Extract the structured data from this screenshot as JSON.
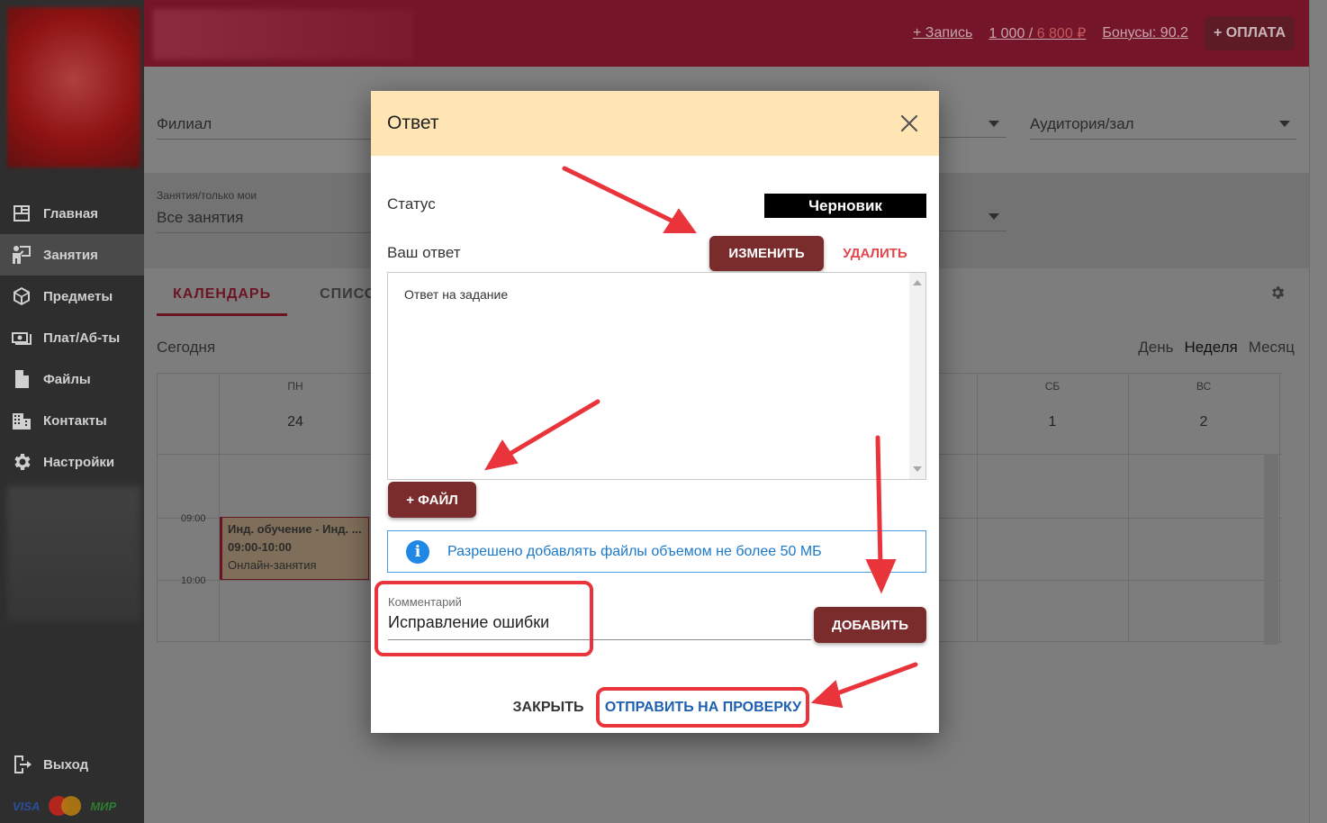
{
  "header": {
    "links": {
      "record": "+ Запись",
      "balance_prefix": "1 000 / ",
      "balance_debt": "6 800 ₽",
      "bonuses": "Бонусы: 90.2"
    },
    "pay_button": "+ ОПЛАТА"
  },
  "sidebar": {
    "items": [
      {
        "label": "Главная",
        "icon": "dashboard-icon"
      },
      {
        "label": "Занятия",
        "icon": "teacher-icon",
        "active": true
      },
      {
        "label": "Предметы",
        "icon": "cube-icon"
      },
      {
        "label": "Плат/Аб-ты",
        "icon": "money-icon"
      },
      {
        "label": "Файлы",
        "icon": "file-icon"
      },
      {
        "label": "Контакты",
        "icon": "building-icon"
      },
      {
        "label": "Настройки",
        "icon": "gear-icon"
      }
    ],
    "logout": "Выход",
    "payment_logos": {
      "visa": "VISA",
      "mir": "МИР"
    }
  },
  "filters": {
    "branch": "Филиал",
    "room": "Аудитория/зал",
    "lessons_label": "Занятия/только мои",
    "lessons_value": "Все занятия"
  },
  "calendar": {
    "tabs": {
      "calendar": "КАЛЕНДАРЬ",
      "list": "СПИСОК"
    },
    "today": "Сегодня",
    "views": {
      "day": "День",
      "week": "Неделя",
      "month": "Месяц"
    },
    "days": [
      {
        "name": "ПН",
        "num": "24"
      },
      {
        "name": "СБ",
        "num": "1"
      },
      {
        "name": "ВС",
        "num": "2"
      }
    ],
    "times": [
      "09:00",
      "10:00"
    ],
    "event": {
      "title": "Инд. обучение - Инд. ...",
      "time": "09:00-10:00",
      "place": "Онлайн-занятия"
    }
  },
  "modal": {
    "title": "Ответ",
    "status_label": "Статус",
    "status_value": "Черновик",
    "answer_label": "Ваш ответ",
    "edit_button": "ИЗМЕНИТЬ",
    "delete_button": "УДАЛИТЬ",
    "answer_text": "Ответ на задание",
    "file_button": "+ ФАЙЛ",
    "info_text": "Разрешено добавлять файлы объемом не более 50 МБ",
    "comment_label": "Комментарий",
    "comment_value": "Исправление ошибки",
    "add_button": "ДОБАВИТЬ",
    "close_button": "ЗАКРЫТЬ",
    "send_button": "ОТПРАВИТЬ НА ПРОВЕРКУ"
  },
  "colors": {
    "header": "#74152a",
    "sidebar": "#2e2e2e",
    "modal_header": "#ffe5b4",
    "primary_button": "#7a2b2b",
    "danger": "#e2474d",
    "link": "#1f5fb0",
    "info": "#1f88e5",
    "annotation": "#e8343a"
  }
}
